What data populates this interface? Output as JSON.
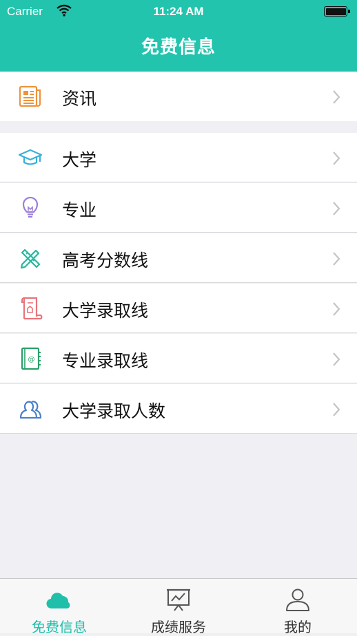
{
  "status_bar": {
    "carrier": "Carrier",
    "time": "11:24 AM"
  },
  "header": {
    "title": "免费信息"
  },
  "sections": [
    {
      "items": [
        {
          "label": "资讯",
          "icon": "newspaper-icon",
          "color": "#f0923a"
        }
      ]
    },
    {
      "items": [
        {
          "label": "大学",
          "icon": "graduation-cap-icon",
          "color": "#3ab0d8"
        },
        {
          "label": "专业",
          "icon": "lightbulb-icon",
          "color": "#9b7fd6"
        },
        {
          "label": "高考分数线",
          "icon": "pencil-ruler-icon",
          "color": "#26b89e"
        },
        {
          "label": "大学录取线",
          "icon": "scroll-icon",
          "color": "#e9737a"
        },
        {
          "label": "专业录取线",
          "icon": "address-book-icon",
          "color": "#29a06a"
        },
        {
          "label": "大学录取人数",
          "icon": "users-icon",
          "color": "#4a7fc9"
        }
      ]
    }
  ],
  "tabbar": {
    "accent_color": "#1fbfaa",
    "tabs": [
      {
        "label": "免费信息",
        "icon": "cloud-icon",
        "active": true
      },
      {
        "label": "成绩服务",
        "icon": "presentation-chart-icon",
        "active": false
      },
      {
        "label": "我的",
        "icon": "user-icon",
        "active": false
      }
    ]
  }
}
